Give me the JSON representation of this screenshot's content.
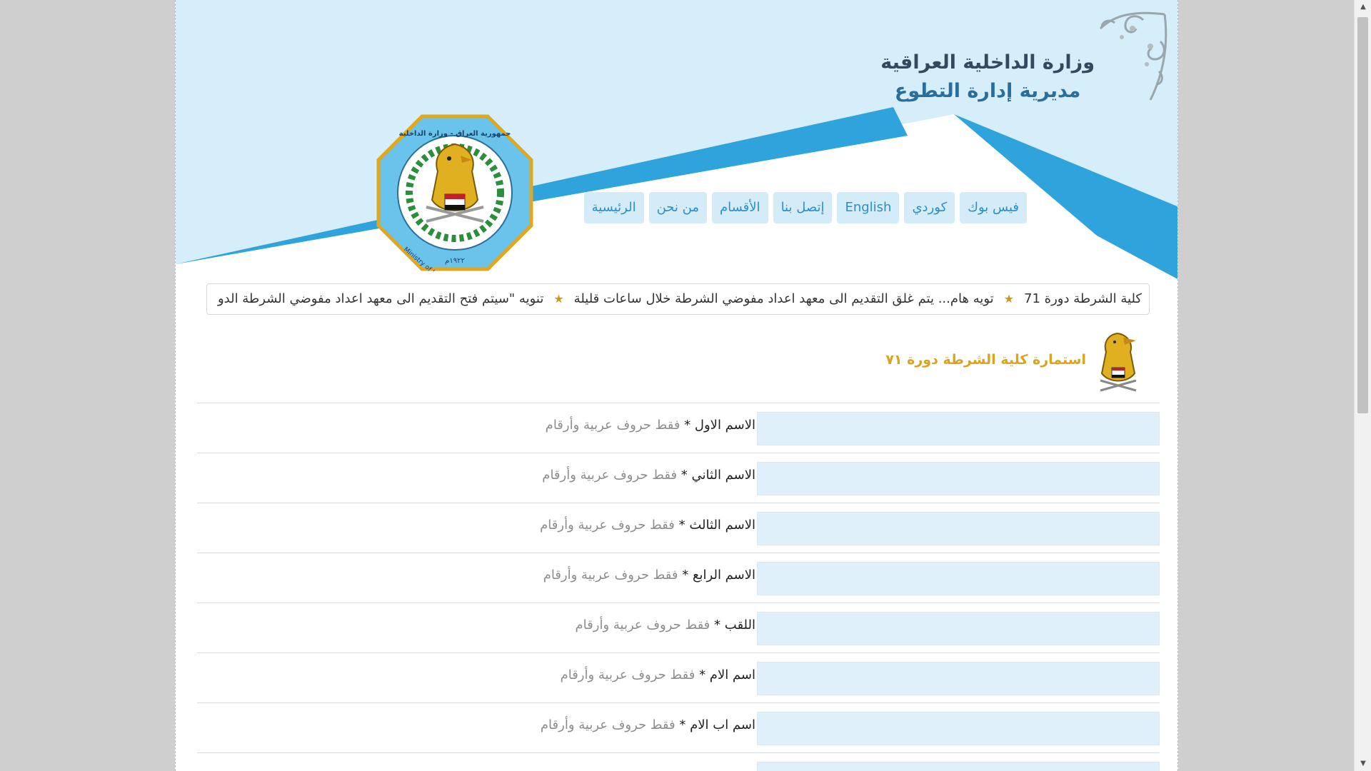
{
  "header": {
    "ministry_line1": "وزارة الداخلية العراقية",
    "ministry_line2": "مديرية إدارة التطوع",
    "emblem_ring_text": "جمهورية العراق - وزارة الداخلية",
    "emblem_en_text": "Ministry of Interior",
    "emblem_year": "١٩٢٢م"
  },
  "nav": {
    "items": [
      {
        "label": "الرئيسية"
      },
      {
        "label": "من نحن"
      },
      {
        "label": "الأقسام"
      },
      {
        "label": "إتصل بنا"
      },
      {
        "label": "English"
      },
      {
        "label": "كوردي"
      },
      {
        "label": "فيس بوك"
      }
    ]
  },
  "ticker": {
    "items": [
      "كلية الشرطة دورة 71",
      "تويه هام... يتم غلق التقديم الى معهد اعداد مفوضي الشرطة خلال ساعات قليلة",
      "تنويه \"سيتم فتح التقديم الى معهد اعداد مفوضي الشرطة الدو"
    ]
  },
  "form": {
    "title": "استمارة كلية الشرطة دورة ٧١",
    "fields": [
      {
        "label": "الاسم الاول",
        "required": "*",
        "hint": "فقط حروف عربية وأرقام",
        "value": ""
      },
      {
        "label": "الاسم الثاني",
        "required": "*",
        "hint": "فقط حروف عربية وأرقام",
        "value": ""
      },
      {
        "label": "الاسم الثالث",
        "required": "*",
        "hint": "فقط حروف عربية وأرقام",
        "value": ""
      },
      {
        "label": "الاسم الرابع",
        "required": "*",
        "hint": "فقط حروف عربية وأرقام",
        "value": ""
      },
      {
        "label": "اللقب",
        "required": "*",
        "hint": "فقط حروف عربية وأرقام",
        "value": ""
      },
      {
        "label": "اسم الام",
        "required": "*",
        "hint": "فقط حروف عربية وأرقام",
        "value": ""
      },
      {
        "label": "اسم اب الام",
        "required": "*",
        "hint": "فقط حروف عربية وأرقام",
        "value": ""
      }
    ]
  },
  "colors": {
    "sky": "#d6eef9",
    "accent_blue": "#2fa3dc",
    "gold": "#d9a520",
    "input_bg": "#dff0fb"
  }
}
